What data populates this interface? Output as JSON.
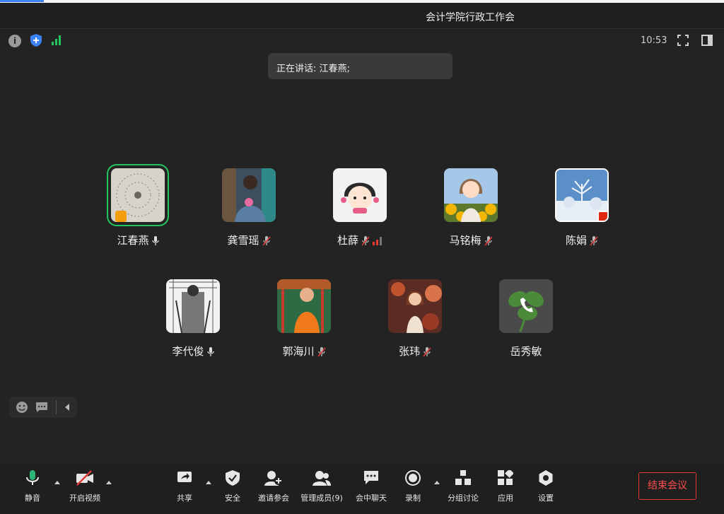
{
  "window": {
    "title": "会计学院行政工作会",
    "clock": "10:53"
  },
  "speaking_banner": "正在讲话: 江春燕;",
  "participants": [
    {
      "name": "江春燕",
      "mic": "on",
      "speaking": true
    },
    {
      "name": "龚雪瑶",
      "mic": "muted"
    },
    {
      "name": "杜薛",
      "mic": "muted",
      "signal": true
    },
    {
      "name": "马铭梅",
      "mic": "muted"
    },
    {
      "name": "陈娟",
      "mic": "muted",
      "flag": "china-flag"
    },
    {
      "name": "李代俊",
      "mic": "on"
    },
    {
      "name": "郭海川",
      "mic": "muted"
    },
    {
      "name": "张玮",
      "mic": "muted"
    },
    {
      "name": "岳秀敏",
      "mic": "none",
      "phone": true
    }
  ],
  "toolbar": {
    "mute": "静音",
    "video": "开启视频",
    "share": "共享",
    "security": "安全",
    "invite": "邀请参会",
    "participants": "管理成员(9)",
    "chat": "会中聊天",
    "record": "录制",
    "breakout": "分组讨论",
    "apps": "应用",
    "settings": "设置",
    "end": "结束会议"
  },
  "colors": {
    "accent_green": "#22c55e",
    "end_red": "#e53935",
    "shield_blue": "#3b82f6"
  }
}
